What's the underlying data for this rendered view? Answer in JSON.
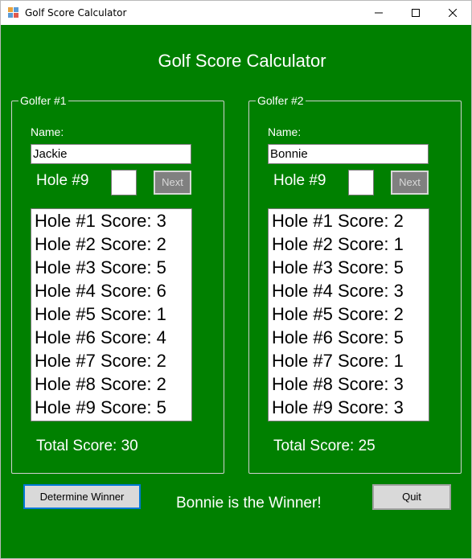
{
  "window": {
    "title": "Golf Score Calculator",
    "icon": "winforms-app-icon",
    "controls": [
      "minimize-icon",
      "maximize-icon",
      "close-icon"
    ]
  },
  "main": {
    "title": "Golf Score Calculator"
  },
  "golfers": [
    {
      "legend": "Golfer #1",
      "name_label": "Name:",
      "name_value": "Jackie",
      "hole_label": "Hole #9",
      "score_value": "",
      "next_label": "Next",
      "scores": [
        "Hole #1 Score: 3",
        "Hole #2 Score: 2",
        "Hole #3 Score: 5",
        "Hole #4 Score: 6",
        "Hole #5 Score: 1",
        "Hole #6 Score: 4",
        "Hole #7 Score: 2",
        "Hole #8 Score: 2",
        "Hole #9 Score: 5"
      ],
      "total": "Total Score: 30"
    },
    {
      "legend": "Golfer #2",
      "name_label": "Name:",
      "name_value": "Bonnie",
      "hole_label": "Hole #9",
      "score_value": "",
      "next_label": "Next",
      "scores": [
        "Hole #1 Score: 2",
        "Hole #2 Score: 1",
        "Hole #3 Score: 5",
        "Hole #4 Score: 3",
        "Hole #5 Score: 2",
        "Hole #6 Score: 5",
        "Hole #7 Score: 1",
        "Hole #8 Score: 3",
        "Hole #9 Score: 3"
      ],
      "total": "Total Score: 25"
    }
  ],
  "footer": {
    "determine_label": "Determine Winner",
    "winner_text": "Bonnie is the Winner!",
    "quit_label": "Quit"
  },
  "colors": {
    "background": "#008000",
    "text": "#ffffff",
    "next_button_disabled": "#808080",
    "focus_border": "#0078d7"
  }
}
